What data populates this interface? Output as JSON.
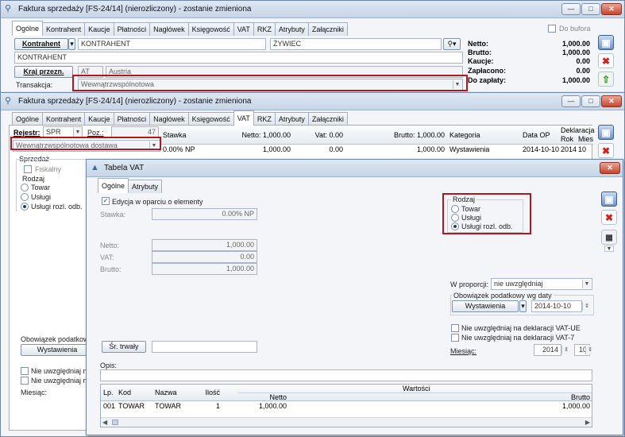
{
  "win1": {
    "title": "Faktura sprzedaży [FS-24/14] (nierozliczony) - zostanie zmieniona",
    "do_bufora": "Do bufora",
    "tabs": [
      "Ogólne",
      "Kontrahent",
      "Kaucje",
      "Płatności",
      "Nagłówek",
      "Księgowość",
      "VAT",
      "RKZ",
      "Atrybuty",
      "Załączniki"
    ],
    "kontrahent_btn": "Kontrahent",
    "kontrahent_code": "KONTRAHENT",
    "kontrahent_city": "ŻYWIEC",
    "kontrahent_name": "KONTRAHENT",
    "kraj_btn": "Kraj przezn.",
    "kraj_code": "AT",
    "kraj_name": "Austria",
    "transakcja_label": "Transakcja:",
    "transakcja_value": "Wewnątrzwspólnotowa",
    "totals": [
      {
        "label": "Netto:",
        "value": "1,000.00"
      },
      {
        "label": "Brutto:",
        "value": "1,000.00"
      },
      {
        "label": "Kaucje:",
        "value": "0.00"
      },
      {
        "label": "Zapłacono:",
        "value": "0.00"
      },
      {
        "label": "Do zapłaty:",
        "value": "1,000.00"
      }
    ]
  },
  "win2": {
    "title": "Faktura sprzedaży [FS-24/14] (nierozliczony) - zostanie zmieniona",
    "tabs": [
      "Ogólne",
      "Kontrahent",
      "Kaucje",
      "Płatności",
      "Nagłówek",
      "Księgowość",
      "VAT",
      "RKZ",
      "Atrybuty",
      "Załączniki"
    ],
    "rejestr_label": "Rejestr:",
    "rejestr_value": "SPR",
    "poz_label": "Poz.:",
    "poz_value": "47",
    "rodzaj_transakcji": "Wewnątrzwspólnotowa dostawa",
    "sprzedaz_label": "Sprzedaż",
    "fiskalny_label": "Fiskalny",
    "rodzaj_label": "Rodzaj",
    "radios": [
      "Towar",
      "Usługi",
      "Usługi rozl. odb."
    ],
    "obowiazek_label": "Obowiązek podatkowy",
    "wystawienia_btn": "Wystawienia",
    "nie_uwzgl_1": "Nie uwzględniaj na d",
    "nie_uwzgl_2": "Nie uwzględniaj na g",
    "miesiac_label": "Miesiąc:",
    "grid_headers": [
      "Stawka",
      "Netto: 1,000.00",
      "Vat: 0.00",
      "Brutto: 1,000.00",
      "Kategoria",
      "Data OP",
      "Deklaracja",
      "Rok",
      "Mies"
    ],
    "grid_row": [
      "0.00% NP",
      "1,000.00",
      "0.00",
      "1,000.00",
      "Wystawienia",
      "2014-10-10",
      "2014",
      "10"
    ]
  },
  "win3": {
    "title": "Tabela VAT",
    "tabs": [
      "Ogólne",
      "Atrybuty"
    ],
    "edycja_label": "Edycja w oparciu o elementy",
    "stawka_label": "Stawka:",
    "stawka_value": "0.00% NP",
    "netto_label": "Netto:",
    "netto_value": "1,000.00",
    "vat_label": "VAT:",
    "vat_value": "0.00",
    "brutto_label": "Brutto:",
    "brutto_value": "1,000.00",
    "rodzaj_label": "Rodzaj",
    "radios": [
      "Towar",
      "Usługi",
      "Usługi rozl. odb."
    ],
    "w_proporcji_label": "W proporcji:",
    "w_proporcji_value": "nie uwzględniaj",
    "obowiazek_label": "Obowiązek podatkowy wg daty",
    "wystawienia_btn": "Wystawienia",
    "data_value": "2014-10-10",
    "nie_vat_ue": "Nie uwzględniaj na deklaracji VAT-UE",
    "nie_vat_7": "Nie uwzględniaj na deklaracji VAT-7",
    "miesiac_label": "Miesiąc:",
    "rok_value": "2014",
    "mies_value": "10",
    "sr_trwaly_btn": "Śr. trwały",
    "opis_label": "Opis:",
    "grid_top_header": "Wartości",
    "grid_headers": [
      "Lp.",
      "Kod",
      "Nazwa",
      "Ilość",
      "Netto",
      "Brutto"
    ],
    "grid_row": [
      "001",
      "TOWAR",
      "TOWAR",
      "1",
      "1,000.00",
      "1,000.00"
    ]
  }
}
